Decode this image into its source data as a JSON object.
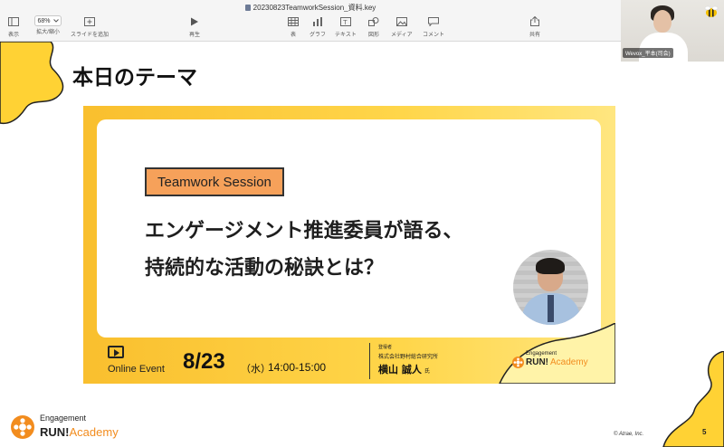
{
  "window": {
    "title": "20230823TeamworkSession_資料.key"
  },
  "toolbar": {
    "view_label": "表示",
    "zoom_value": "68%",
    "zoom_label": "拡大/縮小",
    "add_slide_label": "スライドを追加",
    "play_label": "再生",
    "table_label": "表",
    "chart_label": "グラフ",
    "text_label": "テキスト",
    "shape_label": "図形",
    "media_label": "メディア",
    "comment_label": "コメント",
    "share_label": "共有"
  },
  "video": {
    "participant_name": "Wevox_平本(司会)"
  },
  "slide": {
    "title": "本日のテーマ",
    "badge": "Teamwork Session",
    "headline_line1": "エンゲージメント推進委員が語る、",
    "headline_line2": "持続的な活動の秘訣とは？",
    "event_type": "Online Event",
    "date": "8/23",
    "day": "（水）",
    "time": "14:00-15:00",
    "speaker_role": "登壇者",
    "speaker_org": "株式会社野村総合研究所",
    "speaker_name": "横山 誠人",
    "speaker_honorific": "氏",
    "logo_small": "Engagement",
    "logo_run": "RUN!",
    "logo_academy": "Academy",
    "copyright": "© Atrae, Inc.",
    "page_number": "5"
  },
  "colors": {
    "accent_yellow": "#ffd234",
    "accent_orange": "#f28c1e",
    "badge_fill": "#f6a15a"
  }
}
